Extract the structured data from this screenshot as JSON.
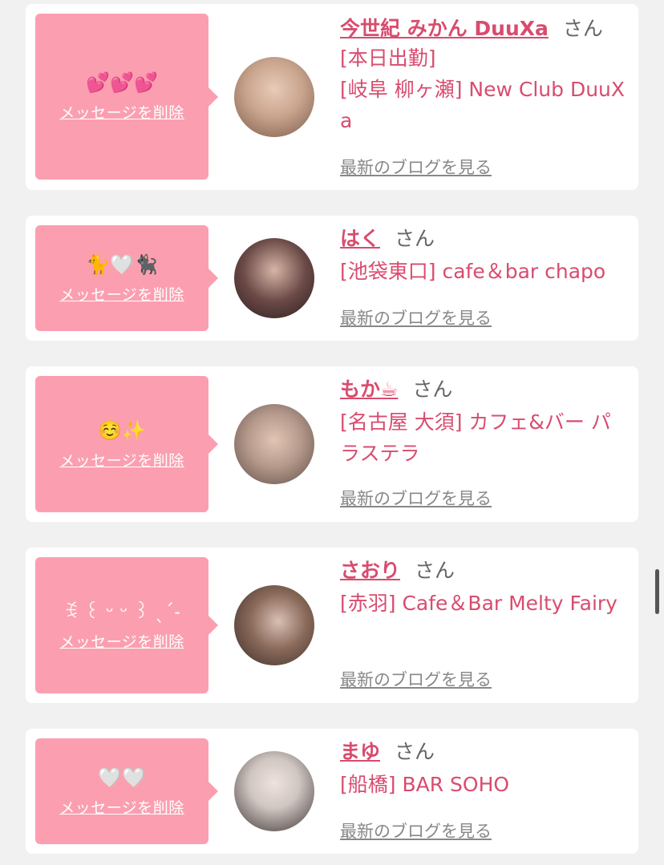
{
  "items": [
    {
      "message": "💕💕💕",
      "delete_label": "メッセージを削除",
      "name": "今世紀 みかん DuuXa",
      "honorific": "さん",
      "status": "[本日出勤]",
      "location": "[岐阜 柳ヶ瀬] New Club DuuXa",
      "blog_label": "最新のブログを見る",
      "avatar_colors": [
        "#c9a48d",
        "#7a5a4a"
      ]
    },
    {
      "message": "🐈🤍🐈‍⬛",
      "delete_label": "メッセージを削除",
      "name": "はく",
      "honorific": "さん",
      "location": "[池袋東口] cafe＆bar chapo",
      "blog_label": "最新のブログを見る",
      "avatar_colors": [
        "#6b4a47",
        "#2b1d1f"
      ]
    },
    {
      "message": "☺️✨",
      "delete_label": "メッセージを削除",
      "name": "もか☕",
      "honorific": "さん",
      "location": "[名古屋 大須] カフェ&バー パラステラ",
      "blog_label": "最新のブログを見る",
      "avatar_colors": [
        "#b59a8c",
        "#5e4b45"
      ]
    },
    {
      "message": "ꉂ ꒰ ᵕ ᵕ ꒱ ˎˊ˗",
      "delete_label": "メッセージを削除",
      "name": "さおり",
      "honorific": "さん",
      "location": "[赤羽] Cafe＆Bar Melty Fairy",
      "blog_label": "最新のブログを見る",
      "avatar_colors": [
        "#8a6a5a",
        "#3a2a26"
      ]
    },
    {
      "message": "🤍🤍",
      "delete_label": "メッセージを削除",
      "name": "まゆ",
      "honorific": "さん",
      "location": "[船橋] BAR SOHO",
      "blog_label": "最新のブログを見る",
      "avatar_colors": [
        "#cfc6c2",
        "#3d3433"
      ]
    }
  ]
}
